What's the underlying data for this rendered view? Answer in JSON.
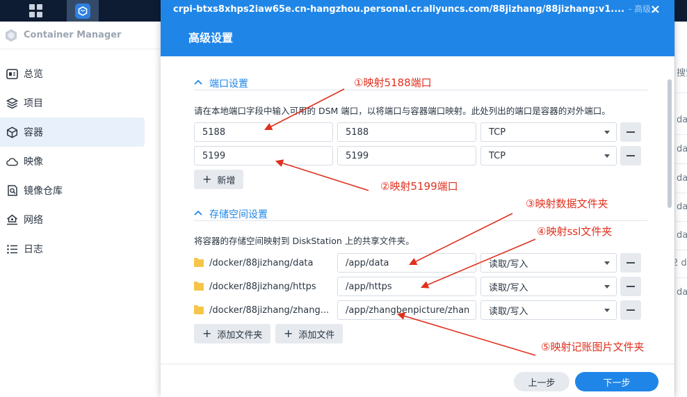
{
  "app": {
    "title": "Container Manager",
    "nav": [
      {
        "label": "总览",
        "icon": "overview-icon"
      },
      {
        "label": "项目",
        "icon": "project-icon"
      },
      {
        "label": "容器",
        "icon": "container-icon",
        "active": true
      },
      {
        "label": "映像",
        "icon": "image-cloud-icon"
      },
      {
        "label": "镜像仓库",
        "icon": "registry-icon"
      },
      {
        "label": "网络",
        "icon": "network-icon"
      },
      {
        "label": "日志",
        "icon": "log-icon"
      }
    ]
  },
  "background": {
    "search_hint": "搜索",
    "cells": [
      "da",
      "da",
      "da",
      "da",
      "da",
      "2 d",
      "da"
    ]
  },
  "modal": {
    "url": "crpi-btxs8xhps2iaw65e.cn-hangzhou.personal.cr.aliyuncs.com/88jizhang/88jizhang:v1....",
    "url_suffix": "- 高级...",
    "title": "高级设置",
    "close": "×",
    "port_section": {
      "heading": "端口设置",
      "desc": "请在本地端口字段中输入可用的 DSM 端口，以将端口与容器端口映射。此处列出的端口是容器的对外端口。",
      "rows": [
        {
          "local": "5188",
          "container": "5188",
          "protocol": "TCP"
        },
        {
          "local": "5199",
          "container": "5199",
          "protocol": "TCP"
        }
      ],
      "add_label": "新增"
    },
    "storage_section": {
      "heading": "存储空间设置",
      "desc": "将容器的存储空间映射到 DiskStation 上的共享文件夹。",
      "rows": [
        {
          "folder": "/docker/88jizhang/data",
          "mount": "/app/data",
          "mode": "读取/写入"
        },
        {
          "folder": "/docker/88jizhang/https",
          "mount": "/app/https",
          "mode": "读取/写入"
        },
        {
          "folder": "/docker/88jizhang/zhang...",
          "mount": "/app/zhangbenpicture/zhan",
          "mode": "读取/写入"
        }
      ],
      "add_folder_label": "添加文件夹",
      "add_file_label": "添加文件"
    },
    "footer": {
      "prev_label": "上一步",
      "next_label": "下一步"
    }
  },
  "annotations": [
    "①映射5188端口",
    "②映射5199端口",
    "③映射数据文件夹",
    "④映射ssl文件夹",
    "⑤映射记账图片文件夹"
  ],
  "colors": {
    "accent": "#1f86e8",
    "annotation": "#e0301e",
    "taskbar": "#0e1c33",
    "folder": "#f6c548"
  }
}
